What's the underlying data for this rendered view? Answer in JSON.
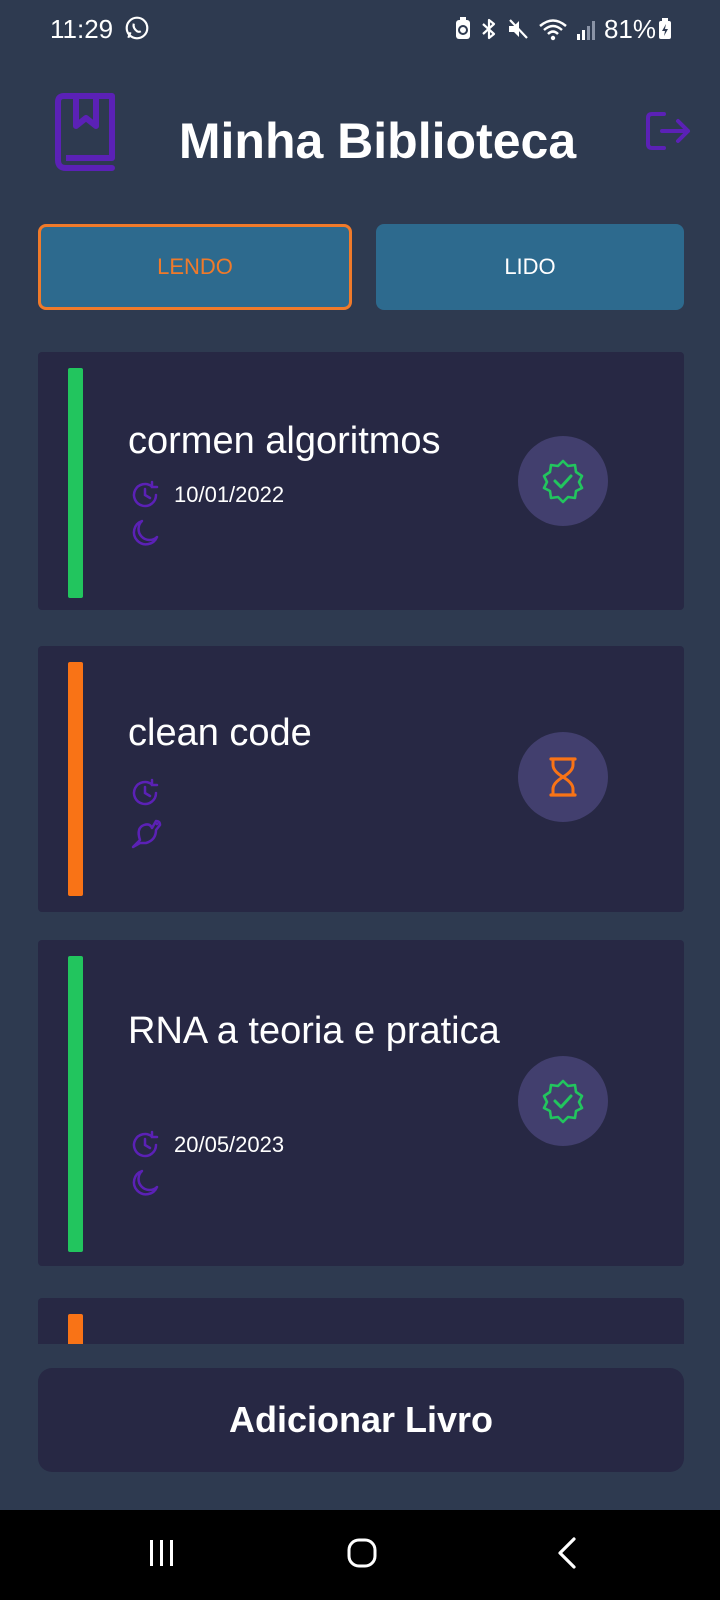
{
  "status_bar": {
    "time": "11:29",
    "battery": "81%",
    "icons": [
      "whatsapp-icon",
      "battery-saver-icon",
      "bluetooth-icon",
      "mute-icon",
      "wifi-icon",
      "signal-icon",
      "battery-icon"
    ]
  },
  "header": {
    "title": "Minha Biblioteca",
    "logo_icon": "bookmark-book-icon",
    "logout_icon": "logout-icon"
  },
  "tabs": [
    {
      "label": "LENDO",
      "active": true
    },
    {
      "label": "LIDO",
      "active": false
    }
  ],
  "books": [
    {
      "title": "cormen algoritmos",
      "date": "10/01/2022",
      "status": "finished",
      "bar_color": "#22c55e",
      "status_icon": "verified-badge-icon",
      "second_icon": "moon-icon"
    },
    {
      "title": "clean code",
      "date": "",
      "status": "pending",
      "bar_color": "#f97316",
      "status_icon": "hourglass-icon",
      "second_icon": "bird-icon"
    },
    {
      "title": "RNA a teoria e pratica",
      "date": "20/05/2023",
      "status": "finished",
      "bar_color": "#22c55e",
      "status_icon": "verified-badge-icon",
      "second_icon": "moon-icon"
    },
    {
      "title": "",
      "date": "",
      "status": "pending",
      "bar_color": "#f97316"
    }
  ],
  "add_button": {
    "label": "Adicionar Livro"
  },
  "nav_bar": {
    "icons": [
      "recents-icon",
      "home-icon",
      "back-icon"
    ]
  },
  "colors": {
    "background": "#2e3a50",
    "card": "#272844",
    "tab": "#2d6a8e",
    "accent_orange": "#f07a2a",
    "accent_purple": "#5b21b6",
    "green": "#22c55e"
  }
}
